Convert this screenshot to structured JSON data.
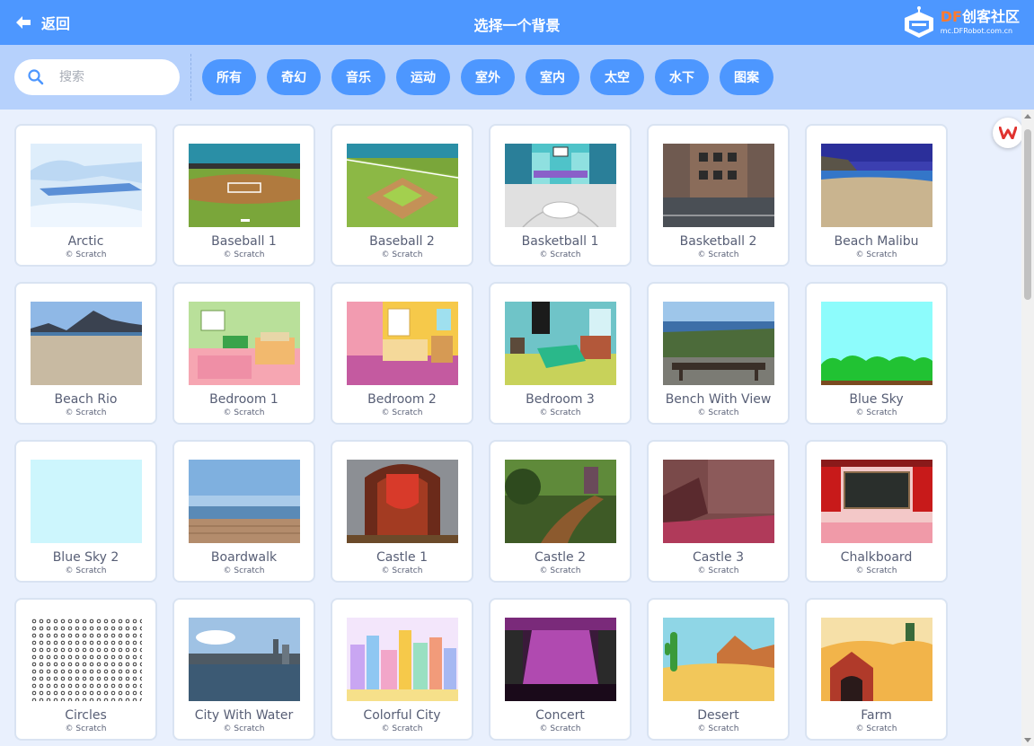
{
  "header": {
    "back_label": "返回",
    "title": "选择一个背景",
    "logo_df": "DF",
    "logo_name": "创客社区",
    "logo_url": "mc.DFRobot.com.cn"
  },
  "search": {
    "placeholder": "搜索",
    "value": ""
  },
  "tags": [
    {
      "label": "所有"
    },
    {
      "label": "奇幻"
    },
    {
      "label": "音乐"
    },
    {
      "label": "运动"
    },
    {
      "label": "室外"
    },
    {
      "label": "室内"
    },
    {
      "label": "太空"
    },
    {
      "label": "水下"
    },
    {
      "label": "图案"
    }
  ],
  "backdrops": [
    {
      "name": "Arctic",
      "credit": "© Scratch"
    },
    {
      "name": "Baseball 1",
      "credit": "© Scratch"
    },
    {
      "name": "Baseball 2",
      "credit": "© Scratch"
    },
    {
      "name": "Basketball 1",
      "credit": "© Scratch"
    },
    {
      "name": "Basketball 2",
      "credit": "© Scratch"
    },
    {
      "name": "Beach Malibu",
      "credit": "© Scratch"
    },
    {
      "name": "Beach Rio",
      "credit": "© Scratch"
    },
    {
      "name": "Bedroom 1",
      "credit": "© Scratch"
    },
    {
      "name": "Bedroom 2",
      "credit": "© Scratch"
    },
    {
      "name": "Bedroom 3",
      "credit": "© Scratch"
    },
    {
      "name": "Bench With View",
      "credit": "© Scratch"
    },
    {
      "name": "Blue Sky",
      "credit": "© Scratch"
    },
    {
      "name": "Blue Sky 2",
      "credit": "© Scratch"
    },
    {
      "name": "Boardwalk",
      "credit": "© Scratch"
    },
    {
      "name": "Castle 1",
      "credit": "© Scratch"
    },
    {
      "name": "Castle 2",
      "credit": "© Scratch"
    },
    {
      "name": "Castle 3",
      "credit": "© Scratch"
    },
    {
      "name": "Chalkboard",
      "credit": "© Scratch"
    },
    {
      "name": "Circles",
      "credit": "© Scratch"
    },
    {
      "name": "City With Water",
      "credit": "© Scratch"
    },
    {
      "name": "Colorful City",
      "credit": "© Scratch"
    },
    {
      "name": "Concert",
      "credit": "© Scratch"
    },
    {
      "name": "Desert",
      "credit": "© Scratch"
    },
    {
      "name": "Farm",
      "credit": "© Scratch"
    }
  ],
  "colors": {
    "header_bg": "#4d97ff",
    "filter_bg": "#b6d1fc",
    "library_bg": "#e9f0fd",
    "tag_bg": "#4d97ff",
    "card_border": "#d9e3f2",
    "text": "#575e75"
  }
}
